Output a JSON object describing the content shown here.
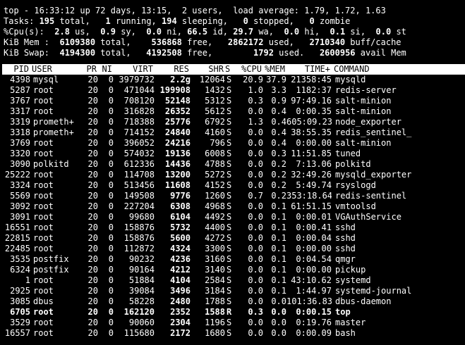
{
  "summary": {
    "top_line": "top - 16:33:12 up 72 days, 13:15,  2 users,  load average: 1.79, 1.72, 1.63",
    "tasks": [
      {
        "t": "Tasks: "
      },
      {
        "t": "195",
        "b": true
      },
      {
        "t": " total,   "
      },
      {
        "t": "1",
        "b": true
      },
      {
        "t": " running, "
      },
      {
        "t": "194",
        "b": true
      },
      {
        "t": " sleeping,   "
      },
      {
        "t": "0",
        "b": true
      },
      {
        "t": " stopped,   "
      },
      {
        "t": "0",
        "b": true
      },
      {
        "t": " zombie"
      }
    ],
    "cpu": [
      {
        "t": "%Cpu(s):  "
      },
      {
        "t": "2.8",
        "b": true
      },
      {
        "t": " us,  "
      },
      {
        "t": "0.9",
        "b": true
      },
      {
        "t": " sy,  "
      },
      {
        "t": "0.0",
        "b": true
      },
      {
        "t": " ni, "
      },
      {
        "t": "66.5",
        "b": true
      },
      {
        "t": " id, "
      },
      {
        "t": "29.7",
        "b": true
      },
      {
        "t": " wa,  "
      },
      {
        "t": "0.0",
        "b": true
      },
      {
        "t": " hi,  "
      },
      {
        "t": "0.1",
        "b": true
      },
      {
        "t": " si,  "
      },
      {
        "t": "0.0",
        "b": true
      },
      {
        "t": " st"
      }
    ],
    "mem": [
      {
        "t": "KiB Mem : "
      },
      {
        "t": " 6109380",
        "b": true
      },
      {
        "t": " total,   "
      },
      {
        "t": " 536868",
        "b": true
      },
      {
        "t": " free,  "
      },
      {
        "t": " 2862172",
        "b": true
      },
      {
        "t": " used,  "
      },
      {
        "t": " 2710340",
        "b": true
      },
      {
        "t": " buff/cache"
      }
    ],
    "swap": [
      {
        "t": "KiB Swap: "
      },
      {
        "t": " 4194300",
        "b": true
      },
      {
        "t": " total,  "
      },
      {
        "t": " 4192508",
        "b": true
      },
      {
        "t": " free,     "
      },
      {
        "t": "   1792",
        "b": true
      },
      {
        "t": " used.  "
      },
      {
        "t": " 2600956",
        "b": true
      },
      {
        "t": " avail Mem"
      }
    ]
  },
  "header": {
    "pid": "PID",
    "user": "USER",
    "pr": "PR",
    "ni": "NI",
    "virt": "VIRT",
    "res": "RES",
    "shr": "SHR",
    "s": "S",
    "cpu": "%CPU",
    "mem": "%MEM",
    "time": "TIME+",
    "cmd": "COMMAND"
  },
  "processes": [
    {
      "pid": "4398",
      "user": "mysql",
      "pr": "20",
      "ni": "0",
      "virt": "3979732",
      "res": "2.2g",
      "shr": "12064",
      "s": "S",
      "cpu": "20.9",
      "mem": "37.9",
      "time": "21358:45",
      "cmd": "mysqld"
    },
    {
      "pid": "5287",
      "user": "root",
      "pr": "20",
      "ni": "0",
      "virt": "471044",
      "res": "199908",
      "shr": "1432",
      "s": "S",
      "cpu": "1.0",
      "mem": "3.3",
      "time": "1182:37",
      "cmd": "redis-server"
    },
    {
      "pid": "3767",
      "user": "root",
      "pr": "20",
      "ni": "0",
      "virt": "708120",
      "res": "52148",
      "shr": "5312",
      "s": "S",
      "cpu": "0.3",
      "mem": "0.9",
      "time": "97:49.16",
      "cmd": "salt-minion"
    },
    {
      "pid": "3317",
      "user": "root",
      "pr": "20",
      "ni": "0",
      "virt": "316828",
      "res": "26352",
      "shr": "5612",
      "s": "S",
      "cpu": "0.0",
      "mem": "0.4",
      "time": "0:00.35",
      "cmd": "salt-minion"
    },
    {
      "pid": "3319",
      "user": "prometh+",
      "pr": "20",
      "ni": "0",
      "virt": "718388",
      "res": "25776",
      "shr": "6792",
      "s": "S",
      "cpu": "1.3",
      "mem": "0.4",
      "time": "605:09.23",
      "cmd": "node_exporter"
    },
    {
      "pid": "3318",
      "user": "prometh+",
      "pr": "20",
      "ni": "0",
      "virt": "714152",
      "res": "24840",
      "shr": "4160",
      "s": "S",
      "cpu": "0.0",
      "mem": "0.4",
      "time": "38:55.35",
      "cmd": "redis_sentinel_"
    },
    {
      "pid": "3769",
      "user": "root",
      "pr": "20",
      "ni": "0",
      "virt": "396052",
      "res": "24216",
      "shr": "796",
      "s": "S",
      "cpu": "0.0",
      "mem": "0.4",
      "time": "0:00.00",
      "cmd": "salt-minion"
    },
    {
      "pid": "3320",
      "user": "root",
      "pr": "20",
      "ni": "0",
      "virt": "574032",
      "res": "19136",
      "shr": "6008",
      "s": "S",
      "cpu": "0.0",
      "mem": "0.3",
      "time": "11:51.85",
      "cmd": "tuned"
    },
    {
      "pid": "3090",
      "user": "polkitd",
      "pr": "20",
      "ni": "0",
      "virt": "612336",
      "res": "14436",
      "shr": "4788",
      "s": "S",
      "cpu": "0.0",
      "mem": "0.2",
      "time": "7:13.06",
      "cmd": "polkitd"
    },
    {
      "pid": "25222",
      "user": "root",
      "pr": "20",
      "ni": "0",
      "virt": "114708",
      "res": "13200",
      "shr": "5272",
      "s": "S",
      "cpu": "0.0",
      "mem": "0.2",
      "time": "32:49.26",
      "cmd": "mysqld_exporter"
    },
    {
      "pid": "3324",
      "user": "root",
      "pr": "20",
      "ni": "0",
      "virt": "513456",
      "res": "11608",
      "shr": "4152",
      "s": "S",
      "cpu": "0.0",
      "mem": "0.2",
      "time": "5:49.74",
      "cmd": "rsyslogd"
    },
    {
      "pid": "5569",
      "user": "root",
      "pr": "20",
      "ni": "0",
      "virt": "149508",
      "res": "9776",
      "shr": "1260",
      "s": "S",
      "cpu": "0.7",
      "mem": "0.2",
      "time": "353:18.64",
      "cmd": "redis-sentinel"
    },
    {
      "pid": "3092",
      "user": "root",
      "pr": "20",
      "ni": "0",
      "virt": "227204",
      "res": "6308",
      "shr": "4968",
      "s": "S",
      "cpu": "0.0",
      "mem": "0.1",
      "time": "61:51.15",
      "cmd": "vmtoolsd"
    },
    {
      "pid": "3091",
      "user": "root",
      "pr": "20",
      "ni": "0",
      "virt": "99680",
      "res": "6104",
      "shr": "4492",
      "s": "S",
      "cpu": "0.0",
      "mem": "0.1",
      "time": "0:00.01",
      "cmd": "VGAuthService"
    },
    {
      "pid": "16551",
      "user": "root",
      "pr": "20",
      "ni": "0",
      "virt": "158876",
      "res": "5732",
      "shr": "4400",
      "s": "S",
      "cpu": "0.0",
      "mem": "0.1",
      "time": "0:00.41",
      "cmd": "sshd"
    },
    {
      "pid": "22815",
      "user": "root",
      "pr": "20",
      "ni": "0",
      "virt": "158876",
      "res": "5600",
      "shr": "4272",
      "s": "S",
      "cpu": "0.0",
      "mem": "0.1",
      "time": "0:00.04",
      "cmd": "sshd"
    },
    {
      "pid": "22485",
      "user": "root",
      "pr": "20",
      "ni": "0",
      "virt": "112872",
      "res": "4324",
      "shr": "3300",
      "s": "S",
      "cpu": "0.0",
      "mem": "0.1",
      "time": "0:00.00",
      "cmd": "sshd"
    },
    {
      "pid": "3535",
      "user": "postfix",
      "pr": "20",
      "ni": "0",
      "virt": "90232",
      "res": "4236",
      "shr": "3160",
      "s": "S",
      "cpu": "0.0",
      "mem": "0.1",
      "time": "0:04.54",
      "cmd": "qmgr"
    },
    {
      "pid": "6324",
      "user": "postfix",
      "pr": "20",
      "ni": "0",
      "virt": "90164",
      "res": "4212",
      "shr": "3140",
      "s": "S",
      "cpu": "0.0",
      "mem": "0.1",
      "time": "0:00.00",
      "cmd": "pickup"
    },
    {
      "pid": "1",
      "user": "root",
      "pr": "20",
      "ni": "0",
      "virt": "51884",
      "res": "4104",
      "shr": "2584",
      "s": "S",
      "cpu": "0.0",
      "mem": "0.1",
      "time": "43:10.62",
      "cmd": "systemd"
    },
    {
      "pid": "2925",
      "user": "root",
      "pr": "20",
      "ni": "0",
      "virt": "39084",
      "res": "3496",
      "shr": "3184",
      "s": "S",
      "cpu": "0.0",
      "mem": "0.1",
      "time": "1:44.97",
      "cmd": "systemd-journal"
    },
    {
      "pid": "3085",
      "user": "dbus",
      "pr": "20",
      "ni": "0",
      "virt": "58228",
      "res": "2480",
      "shr": "1788",
      "s": "S",
      "cpu": "0.0",
      "mem": "0.0",
      "time": "101:36.83",
      "cmd": "dbus-daemon"
    },
    {
      "pid": "6705",
      "user": "root",
      "pr": "20",
      "ni": "0",
      "virt": "162120",
      "res": "2352",
      "shr": "1588",
      "s": "R",
      "cpu": "0.3",
      "mem": "0.0",
      "time": "0:00.15",
      "cmd": "top",
      "self": true
    },
    {
      "pid": "3529",
      "user": "root",
      "pr": "20",
      "ni": "0",
      "virt": "90060",
      "res": "2304",
      "shr": "1196",
      "s": "S",
      "cpu": "0.0",
      "mem": "0.0",
      "time": "0:19.76",
      "cmd": "master"
    },
    {
      "pid": "16557",
      "user": "root",
      "pr": "20",
      "ni": "0",
      "virt": "115680",
      "res": "2172",
      "shr": "1680",
      "s": "S",
      "cpu": "0.0",
      "mem": "0.0",
      "time": "0:00.09",
      "cmd": "bash"
    }
  ]
}
